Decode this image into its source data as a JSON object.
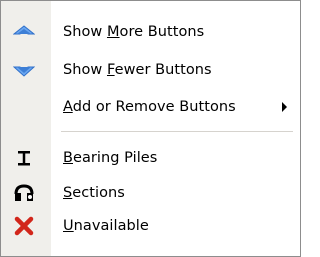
{
  "menu": {
    "items": [
      {
        "pre": "Show ",
        "key": "M",
        "post": "ore Buttons",
        "icon": "show-more-icon"
      },
      {
        "pre": "Show ",
        "key": "F",
        "post": "ewer Buttons",
        "icon": "show-fewer-icon"
      },
      {
        "pre": "",
        "key": "A",
        "post": "dd or Remove Buttons",
        "icon": ""
      },
      {
        "pre": "",
        "key": "B",
        "post": "earing Piles",
        "icon": "bearing-piles-icon"
      },
      {
        "pre": "",
        "key": "S",
        "post": "ections",
        "icon": "sections-icon"
      },
      {
        "pre": "",
        "key": "U",
        "post": "navailable",
        "icon": "unavailable-icon"
      }
    ]
  },
  "colors": {
    "gutter": "#f0efeb",
    "border": "#8d8d8d",
    "up_arrow": "#3d7fd6",
    "down_arrow": "#3d7fd6",
    "unavailable_x": "#d2261b"
  }
}
